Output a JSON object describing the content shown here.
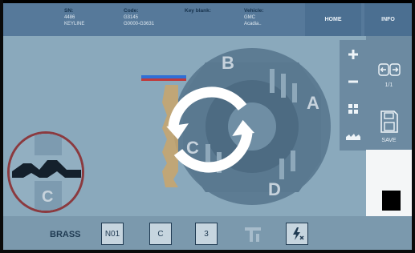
{
  "header": {
    "sn": {
      "label": "SN:",
      "line1": "4486",
      "line2": "KEYLINE"
    },
    "code": {
      "label": "Code:",
      "line1": "G3145",
      "line2": "G0000-G3631"
    },
    "key_blank": {
      "label": "Key blank:"
    },
    "vehicle": {
      "label": "Vehicle:",
      "line1": "GMC",
      "line2": "Acadia.."
    },
    "home_label": "HOME",
    "info_label": "INFO"
  },
  "side_panel": {
    "page_indicator": "1/1",
    "save_label": "SAVE"
  },
  "key_view": {
    "side_letters": [
      "B",
      "A",
      "D",
      "C"
    ],
    "magnifier_letter": "C"
  },
  "toolbar": {
    "material": "BRASS",
    "buttons": [
      {
        "id": "no1",
        "label": "N01"
      },
      {
        "id": "side",
        "label": "C"
      },
      {
        "id": "cuts",
        "label": "3"
      }
    ]
  },
  "icons": {
    "zoom_in": "plus-icon",
    "zoom_out": "minus-icon",
    "grid": "grid-icon",
    "depth": "depth-icon",
    "arrows": "arrows-icon",
    "save": "floppy-disk-icon",
    "caliper": "caliper-icon",
    "power": "power-icon",
    "loading": "rotate-icon"
  },
  "colors": {
    "header": "#56799a",
    "background": "#8aa9bc",
    "accent_red": "#8b3a3f",
    "highlight_blue": "#2f6fd6"
  }
}
